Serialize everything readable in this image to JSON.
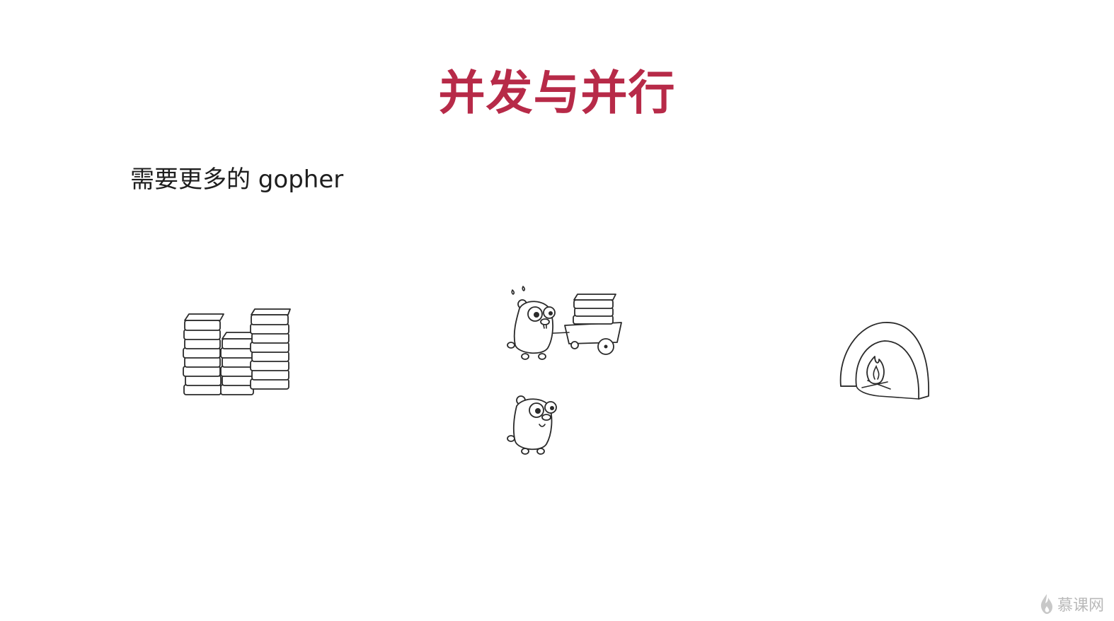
{
  "slide": {
    "title": "并发与并行",
    "subtitle": "需要更多的 gopher",
    "title_color": "#b72a48"
  },
  "illustrations": [
    {
      "name": "book-stacks-icon"
    },
    {
      "name": "gopher-pushing-cart-icon"
    },
    {
      "name": "gopher-idle-icon"
    },
    {
      "name": "furnace-with-fire-icon"
    }
  ],
  "watermark": {
    "text": "慕课网",
    "icon": "flame-logo-icon"
  }
}
